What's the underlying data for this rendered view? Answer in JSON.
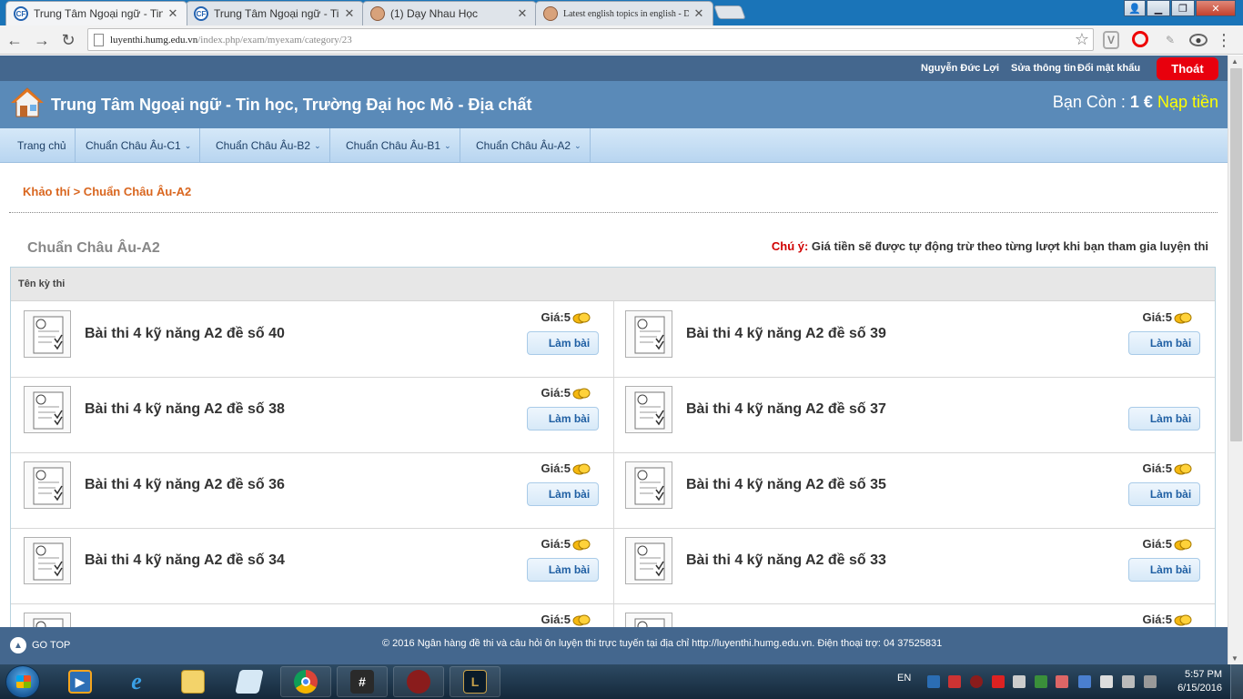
{
  "browser": {
    "tabs": [
      {
        "title": "Trung Tâm Ngoại ngữ - Tin",
        "favicon": "cf-logo-icon",
        "active": true
      },
      {
        "title": "Trung Tâm Ngoại ngữ - Tin",
        "favicon": "cf-logo-icon",
        "active": false
      },
      {
        "title": "(1) Dạy Nhau Học",
        "favicon": "avatar-face-icon",
        "active": false
      },
      {
        "title": "Latest english topics in english - Dạy",
        "favicon": "avatar-face-icon",
        "active": false
      }
    ],
    "url_host": "luyenthi.humg.edu.vn",
    "url_path": "/index.php/exam/myexam/category/23"
  },
  "topbar": {
    "user_name": "Nguyễn Đức Lợi",
    "edit_profile": "Sửa thông tin",
    "change_password": "Đổi mật khẩu",
    "logout": "Thoát"
  },
  "banner": {
    "site_title": "Trung Tâm Ngoại ngữ - Tin học, Trường Đại học Mỏ - Địa chất",
    "balance_label": "Bạn Còn :",
    "balance_amount": "1 €",
    "topup": "Nạp tiền"
  },
  "nav": {
    "items": [
      {
        "label": "Trang chủ",
        "dropdown": false
      },
      {
        "label": "Chuẩn Châu Âu-C1",
        "dropdown": true
      },
      {
        "label": "Chuẩn Châu Âu-B2",
        "dropdown": true
      },
      {
        "label": "Chuẩn Châu Âu-B1",
        "dropdown": true
      },
      {
        "label": "Chuẩn Châu Âu-A2",
        "dropdown": true
      }
    ]
  },
  "breadcrumb": "Khảo thí > Chuẩn Châu Âu-A2",
  "section": {
    "title": "Chuẩn Châu Âu-A2",
    "notice_label": "Chú ý:",
    "notice_text": " Giá tiền sẽ được tự động trừ theo từng lượt khi bạn tham gia luyện thi"
  },
  "table": {
    "header": "Tên kỳ thi",
    "button_label": "Làm bài",
    "price_label": "Giá:",
    "exams": [
      {
        "name": "Bài thi 4 kỹ năng A2 đề số 40",
        "price": "5",
        "show_price": true
      },
      {
        "name": "Bài thi 4 kỹ năng A2 đề số 39",
        "price": "5",
        "show_price": true
      },
      {
        "name": "Bài thi 4 kỹ năng A2 đề số 38",
        "price": "5",
        "show_price": true
      },
      {
        "name": "Bài thi 4 kỹ năng A2 đề số 37",
        "price": "",
        "show_price": false
      },
      {
        "name": "Bài thi 4 kỹ năng A2 đề số 36",
        "price": "5",
        "show_price": true
      },
      {
        "name": "Bài thi 4 kỹ năng A2 đề số 35",
        "price": "5",
        "show_price": true
      },
      {
        "name": "Bài thi 4 kỹ năng A2 đề số 34",
        "price": "5",
        "show_price": true
      },
      {
        "name": "Bài thi 4 kỹ năng A2 đề số 33",
        "price": "5",
        "show_price": true
      },
      {
        "name": "",
        "price": "5",
        "show_price": true
      },
      {
        "name": "",
        "price": "5",
        "show_price": true
      }
    ]
  },
  "footer": {
    "go_top": "GO TOP",
    "copyright": "© 2016 Ngân hàng đề thi và câu hỏi ôn luyện thi trực tuyến tại địa chỉ http://luyenthi.humg.edu.vn. Điện thoại trợ: 04 37525831"
  },
  "taskbar": {
    "language": "EN",
    "time": "5:57 PM",
    "date": "6/15/2016",
    "apps": [
      "media-player-icon",
      "internet-explorer-icon",
      "file-explorer-icon",
      "notepad-icon",
      "chrome-icon",
      "hashtag-app-icon",
      "game-avatar-icon",
      "league-of-legends-icon"
    ]
  },
  "colors": {
    "topbar": "#44678e",
    "banner": "#5a8ab8",
    "accent_orange": "#d9661f",
    "logout_red": "#e8000d",
    "topup_yellow": "#ffff00"
  }
}
